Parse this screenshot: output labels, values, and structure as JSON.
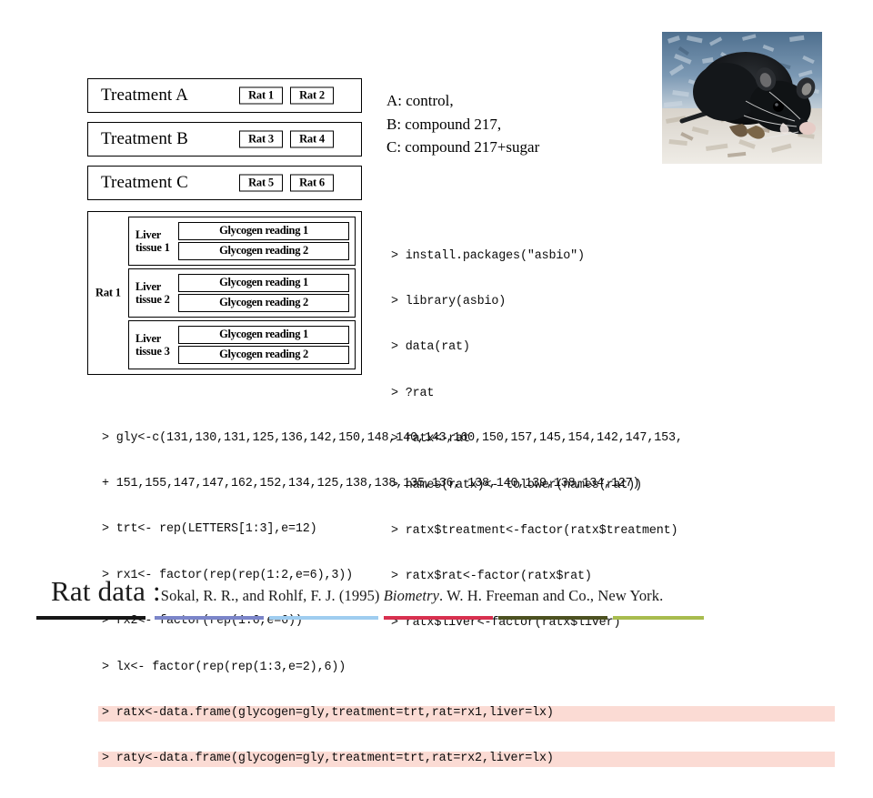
{
  "treatments": [
    {
      "label": "Treatment A",
      "rats": [
        "Rat 1",
        "Rat 2"
      ]
    },
    {
      "label": "Treatment B",
      "rats": [
        "Rat 3",
        "Rat 4"
      ]
    },
    {
      "label": "Treatment C",
      "rats": [
        "Rat 5",
        "Rat 6"
      ]
    }
  ],
  "legend": {
    "line_a": "A: control,",
    "line_b": "B: compound 217,",
    "line_c": "C: compound 217+sugar"
  },
  "nesting": {
    "rat_label": "Rat 1",
    "tissues": [
      {
        "name": "Liver tissue 1",
        "readings": [
          "Glycogen reading 1",
          "Glycogen reading 2"
        ]
      },
      {
        "name": "Liver tissue 2",
        "readings": [
          "Glycogen reading 1",
          "Glycogen reading 2"
        ]
      },
      {
        "name": "Liver tissue 3",
        "readings": [
          "Glycogen reading 1",
          "Glycogen reading 2"
        ]
      }
    ]
  },
  "console_right": {
    "lines": [
      "> install.packages(\"asbio\")",
      "> library(asbio)",
      "> data(rat)",
      "> ?rat",
      "> ratx<-rat",
      "> names(ratx)<- tolower(names(rat))",
      "> ratx$treatment<-factor(ratx$treatment)",
      "> ratx$rat<-factor(ratx$rat)",
      "> ratx$liver<-factor(ratx$liver)"
    ]
  },
  "console_bottom": {
    "lines": [
      {
        "text": "> gly<-c(131,130,131,125,136,142,150,148,140,143,160,150,157,145,154,142,147,153,",
        "highlight": false
      },
      {
        "text": "+ 151,155,147,147,162,152,134,125,138,138,135,136, 138,140,139,138,134,127)",
        "highlight": false
      },
      {
        "text": "> trt<- rep(LETTERS[1:3],e=12)",
        "highlight": false
      },
      {
        "text": "> rx1<- factor(rep(rep(1:2,e=6),3))",
        "highlight": false
      },
      {
        "text": "> rx2<- factor(rep(1:6,e=6))",
        "highlight": false
      },
      {
        "text": "> lx<- factor(rep(rep(1:3,e=2),6))",
        "highlight": false
      },
      {
        "text": "> ratx<-data.frame(glycogen=gly,treatment=trt,rat=rx1,liver=lx)",
        "highlight": true
      },
      {
        "text": "> raty<-data.frame(glycogen=gly,treatment=trt,rat=rx2,liver=lx)",
        "highlight": true
      }
    ]
  },
  "footer": {
    "title": "Rat data :",
    "citation_pre": "Sokal, R. R., and Rohlf, F. J. (1995) ",
    "citation_italic": "Biometry",
    "citation_post": ". W. H. Freeman and Co., New York."
  },
  "colors": {
    "highlight": "#fbdbd4",
    "rule_black": "#161616",
    "rule_periwinkle": "#7b85c9",
    "rule_lightblue": "#9fcdf0",
    "rule_crimson": "#d8304f",
    "rule_darkolive": "#4c5120",
    "rule_lightolive": "#a8bc4e"
  },
  "photo": {
    "alt": "black laboratory rat on bedding"
  }
}
